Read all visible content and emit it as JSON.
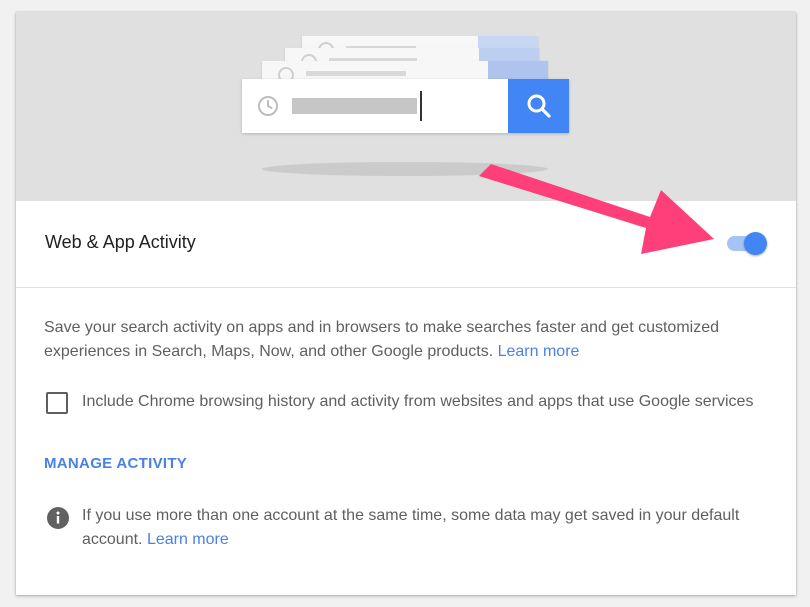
{
  "colors": {
    "accent": "#4285f4",
    "link": "#4a80e8",
    "arrow": "#ff3f79",
    "hero_bg": "#e0e0e0"
  },
  "hero": {
    "icons": [
      "clock-icon",
      "search-icon"
    ]
  },
  "setting": {
    "title": "Web & App Activity",
    "toggle_on": true
  },
  "description": {
    "text": "Save your search activity on apps and in browsers to make searches faster and get customized experiences in Search, Maps, Now, and other Google products.",
    "link": "Learn more"
  },
  "chrome_option": {
    "checked": false,
    "label": "Include Chrome browsing history and activity from websites and apps that use Google services"
  },
  "manage_link": "MANAGE ACTIVITY",
  "info": {
    "icon": "info-icon",
    "text": "If you use more than one account at the same time, some data may get saved in your default account.",
    "link": "Learn more"
  }
}
